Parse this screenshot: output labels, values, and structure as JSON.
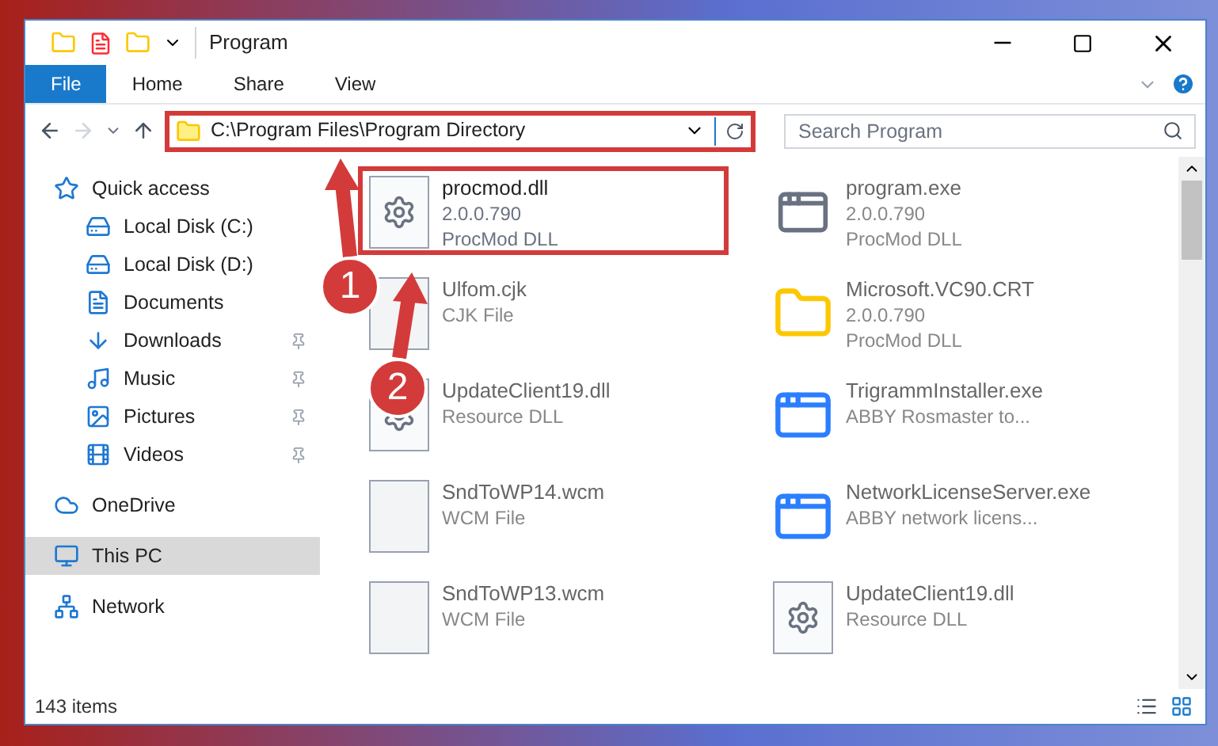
{
  "window": {
    "title": "Program"
  },
  "ribbon": {
    "tabs": [
      {
        "label": "File",
        "selected": true
      },
      {
        "label": "Home",
        "selected": false
      },
      {
        "label": "Share",
        "selected": false
      },
      {
        "label": "View",
        "selected": false
      }
    ]
  },
  "address_bar": {
    "path": "C:\\Program Files\\Program Directory",
    "highlighted": true
  },
  "search": {
    "placeholder": "Search Program"
  },
  "sidebar": {
    "items": [
      {
        "label": "Quick access",
        "selected": false,
        "pinned": false,
        "children": [
          {
            "label": "Local Disk (C:)",
            "selected": false,
            "pinned": false
          },
          {
            "label": "Local Disk (D:)",
            "selected": false,
            "pinned": false
          },
          {
            "label": "Documents",
            "selected": false,
            "pinned": false
          },
          {
            "label": "Downloads",
            "selected": false,
            "pinned": true
          },
          {
            "label": "Music",
            "selected": false,
            "pinned": true
          },
          {
            "label": "Pictures",
            "selected": false,
            "pinned": true
          },
          {
            "label": "Videos",
            "selected": false,
            "pinned": true
          }
        ]
      },
      {
        "label": "OneDrive",
        "selected": false,
        "pinned": false
      },
      {
        "label": "This PC",
        "selected": true,
        "pinned": false
      },
      {
        "label": "Network",
        "selected": false,
        "pinned": false
      }
    ]
  },
  "files": [
    {
      "name": "procmod.dll",
      "lines": [
        "2.0.0.790",
        "ProcMod DLL"
      ],
      "kind": "library",
      "highlighted": true
    },
    {
      "name": "program.exe",
      "lines": [
        "2.0.0.790",
        "ProcMod DLL"
      ],
      "kind": "program",
      "highlighted": false
    },
    {
      "name": "Ulfom.cjk",
      "lines": [
        "CJK File"
      ],
      "kind": "document",
      "highlighted": false
    },
    {
      "name": "Microsoft.VC90.CRT",
      "lines": [
        "2.0.0.790",
        "ProcMod DLL"
      ],
      "kind": "folder",
      "highlighted": false
    },
    {
      "name": "UpdateClient19.dll",
      "lines": [
        "Resource DLL"
      ],
      "kind": "library",
      "highlighted": false
    },
    {
      "name": "TrigrammInstaller.exe",
      "lines": [
        "ABBY Rosmaster to..."
      ],
      "kind": "installer",
      "highlighted": false
    },
    {
      "name": "SndToWP14.wcm",
      "lines": [
        "WCM File"
      ],
      "kind": "document",
      "highlighted": false
    },
    {
      "name": "NetworkLicenseServer.exe",
      "lines": [
        "ABBY network licens..."
      ],
      "kind": "installer",
      "highlighted": false
    },
    {
      "name": "SndToWP13.wcm",
      "lines": [
        "WCM File"
      ],
      "kind": "document",
      "highlighted": false
    },
    {
      "name": "UpdateClient19.dll",
      "lines": [
        "Resource DLL"
      ],
      "kind": "library",
      "highlighted": false
    }
  ],
  "status_bar": {
    "count": "143 items"
  },
  "annotations": [
    {
      "label": "1"
    },
    {
      "label": "2"
    }
  ]
}
